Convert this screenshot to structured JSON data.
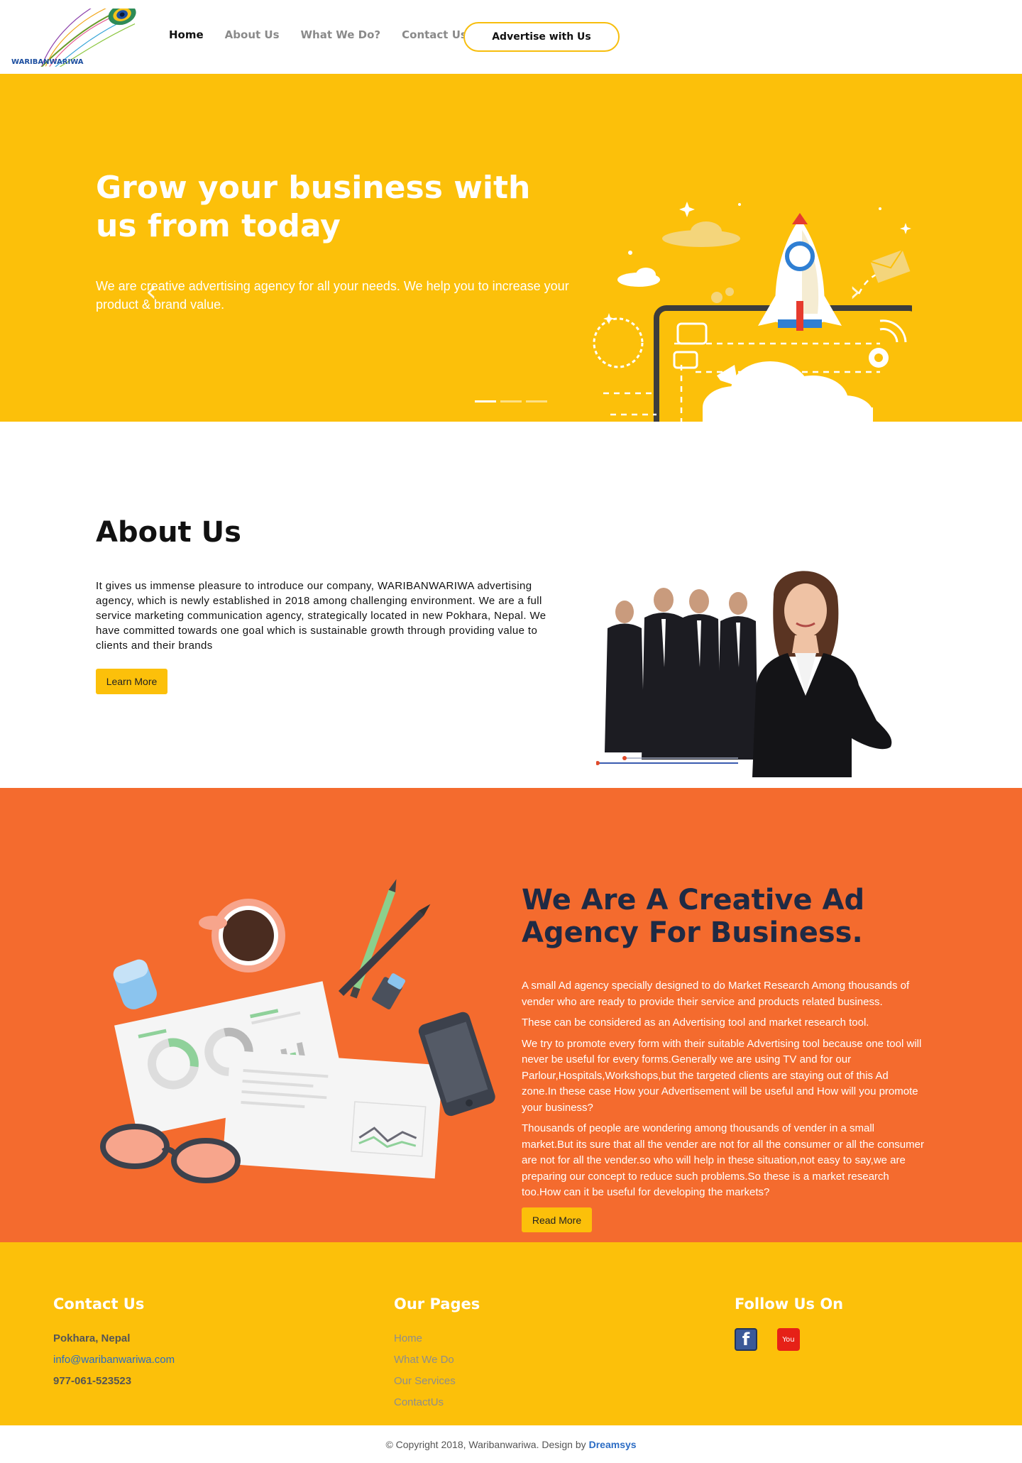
{
  "brand": {
    "name": "WARIBANWARIWA"
  },
  "nav": {
    "items": [
      "Home",
      "About Us",
      "What We Do?",
      "Contact Us"
    ],
    "cta": "Advertise with Us"
  },
  "hero": {
    "title": "Grow your business with us from today",
    "text": "We are creative advertising agency for all your needs. We help you to increase your product & brand value.",
    "prev": "‹",
    "next": "›",
    "active_slide": 1,
    "slide_count": 3
  },
  "about": {
    "title": "About Us",
    "text": "It gives us immense pleasure to introduce our company, WARIBANWARIWA advertising agency, which is newly established in 2018 among challenging environment. We are a full service marketing communication agency, strategically located in new Pokhara, Nepal. We have committed towards one goal which is sustainable growth through providing value to clients and their brands",
    "button": "Learn More"
  },
  "creative": {
    "title": "We Are A Creative Ad Agency For Business.",
    "paragraphs": [
      "A small Ad agency specially designed to do Market Research Among thousands of vender who are ready to provide their service and products related business.",
      "These can be considered as an Advertising tool and market research tool.",
      "We try to promote every form with their suitable Advertising tool because one tool will never be useful for every forms.Generally we are using TV and for our Parlour,Hospitals,Workshops,but the targeted clients are staying out of this Ad zone.In these case How your Advertisement will be useful and How will you promote your business?",
      "Thousands of people are wondering among thousands of vender in a small market.But its sure that all the vender are not for all the consumer or all the consumer are not for all the vender.so who will help in these situation,not easy to say,we are preparing our concept to reduce such problems.So these is a market research too.How can it be useful for developing the markets?"
    ],
    "button": "Read More"
  },
  "footer": {
    "contact": {
      "title": "Contact Us",
      "address": "Pokhara, Nepal",
      "email": "info@waribanwariwa.com",
      "phone": "977-061-523523"
    },
    "pages": {
      "title": "Our Pages",
      "items": [
        "Home",
        "What We Do",
        "Our Services",
        "ContactUs"
      ]
    },
    "follow": {
      "title": "Follow Us On",
      "icons": [
        "facebook-icon",
        "youtube-icon"
      ],
      "fb_glyph": "f",
      "yt_glyph": "You"
    },
    "copyright": "© Copyright 2018, Waribanwariwa. Design by",
    "designer": "Dreamsys"
  }
}
